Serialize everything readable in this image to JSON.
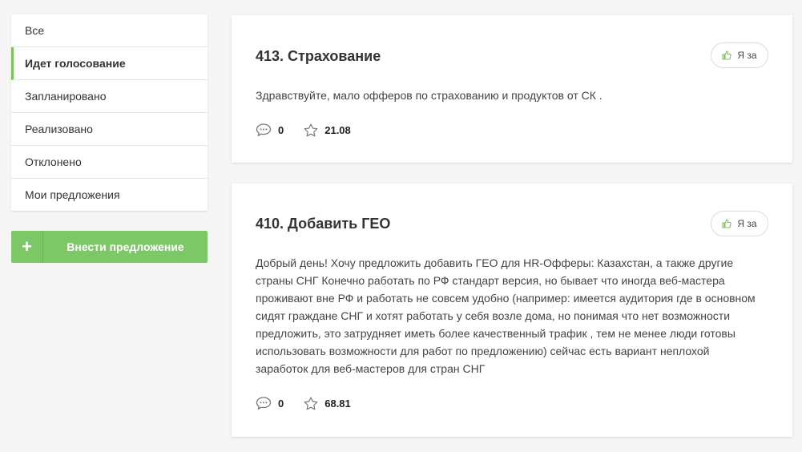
{
  "sidebar": {
    "filters": [
      {
        "label": "Все"
      },
      {
        "label": "Идет голосование"
      },
      {
        "label": "Запланировано"
      },
      {
        "label": "Реализовано"
      },
      {
        "label": "Отклонено"
      },
      {
        "label": "Мои предложения"
      }
    ],
    "add_button": {
      "icon": "+",
      "label": "Внести предложение"
    }
  },
  "accent_color": "#7dc866",
  "suggestions": [
    {
      "title": "413. Страхование",
      "vote_label": "Я за",
      "text": "Здравствуйте, мало офферов по страхованию и продуктов от СК .",
      "comments": "0",
      "rating": "21.08"
    },
    {
      "title": "410. Добавить ГЕО",
      "vote_label": "Я за",
      "text": "Добрый день! Хочу предложить добавить ГЕО для HR-Офферы: Казахстан, а также другие страны СНГ Конечно работать по РФ стандарт версия, но бывает что иногда веб-мастера проживают вне РФ и работать не совсем удобно (например: имеется аудитория где в основном сидят граждане СНГ и хотят работать у себя возле дома, но понимая что нет возможности предложить, это затрудняет иметь более качественный трафик , тем не менее люди готовы использовать возможности для работ по предложению) сейчас есть вариант неплохой заработок для веб-мастеров для стран СНГ",
      "comments": "0",
      "rating": "68.81"
    }
  ]
}
